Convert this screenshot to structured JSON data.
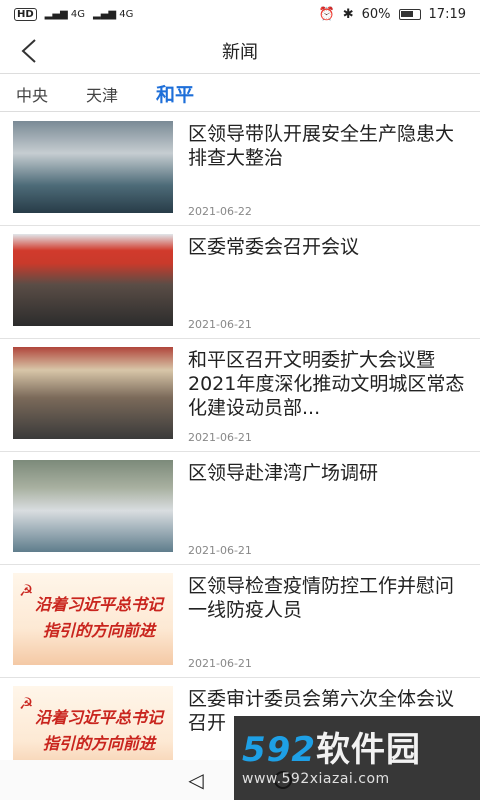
{
  "status_bar": {
    "left_badge": "HD",
    "network1": "4G",
    "network2": "4G",
    "battery": "60%",
    "time": "17:19"
  },
  "header": {
    "title": "新闻"
  },
  "tabs": [
    {
      "label": "中央",
      "active": false
    },
    {
      "label": "天津",
      "active": false
    },
    {
      "label": "和平",
      "active": true
    }
  ],
  "news": [
    {
      "title": "区领导带队开展安全生产隐患大排查大整治",
      "date": "2021-06-22"
    },
    {
      "title": "区委常委会召开会议",
      "date": "2021-06-21"
    },
    {
      "title": "和平区召开文明委扩大会议暨2021年度深化推动文明城区常态化建设动员部...",
      "date": "2021-06-21"
    },
    {
      "title": "区领导赴津湾广场调研",
      "date": "2021-06-21"
    },
    {
      "title": "区领导检查疫情防控工作并慰问一线防疫人员",
      "date": "2021-06-21"
    },
    {
      "title": "区委审计委员会第六次全体会议召开",
      "date": ""
    }
  ],
  "banner": {
    "line1": "沿着习近平总书记",
    "line2": "指引的方向前进"
  },
  "watermark": {
    "brand_num": "592",
    "brand_text": "软件园",
    "url": "www.592xiazai.com"
  }
}
